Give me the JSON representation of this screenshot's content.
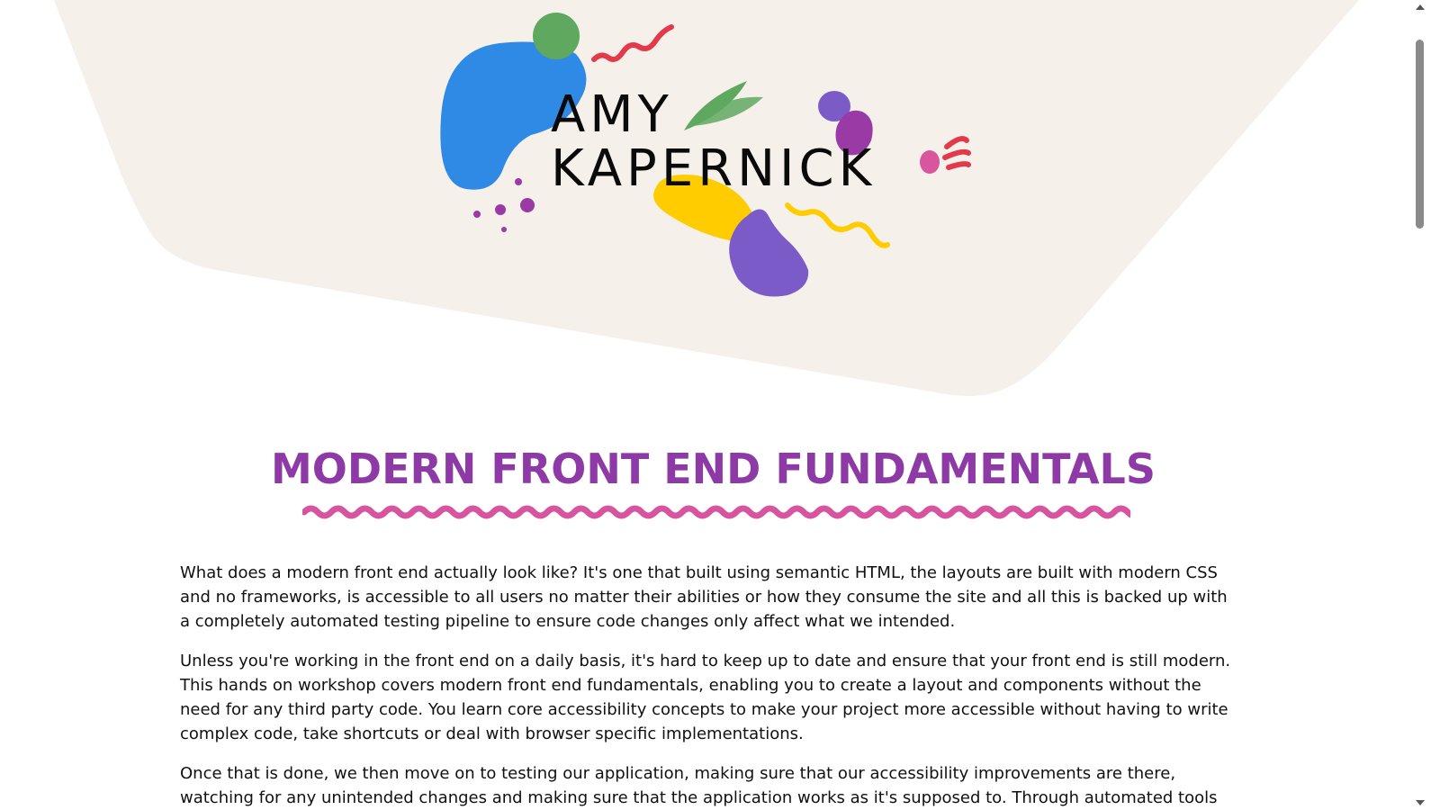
{
  "colors": {
    "hero_background": "#f6f0eb",
    "title": "#8e3aa6",
    "squiggle": "#d6559e",
    "logo_blue": "#2f8ae6",
    "logo_green": "#5fa85f",
    "logo_red": "#e23a4a",
    "logo_purple": "#7b5bc8",
    "logo_magenta": "#9a3aa4",
    "logo_yellow": "#ffcc00",
    "logo_pink": "#d9559d"
  },
  "logo": {
    "line1": "AMY",
    "line2": "KAPERNICK"
  },
  "main": {
    "title": "MODERN FRONT END FUNDAMENTALS",
    "paragraphs": [
      "What does a modern front end actually look like? It's one that built using semantic HTML, the layouts are built with modern CSS and no frameworks, is accessible to all users no matter their abilities or how they consume the site and all this is backed up with a completely automated testing pipeline to ensure code changes only affect what we intended.",
      "Unless you're working in the front end on a daily basis, it's hard to keep up to date and ensure that your front end is still modern. This hands on workshop covers modern front end fundamentals, enabling you to create a layout and components without the need for any third party code. You learn core accessibility concepts to make your project more accessible without having to write complex code, take shortcuts or deal with browser specific implementations.",
      "Once that is done, we then move on to testing our application, making sure that our accessibility improvements are there, watching for any unintended changes and making sure that the application works as it's supposed to. Through automated tools"
    ]
  }
}
